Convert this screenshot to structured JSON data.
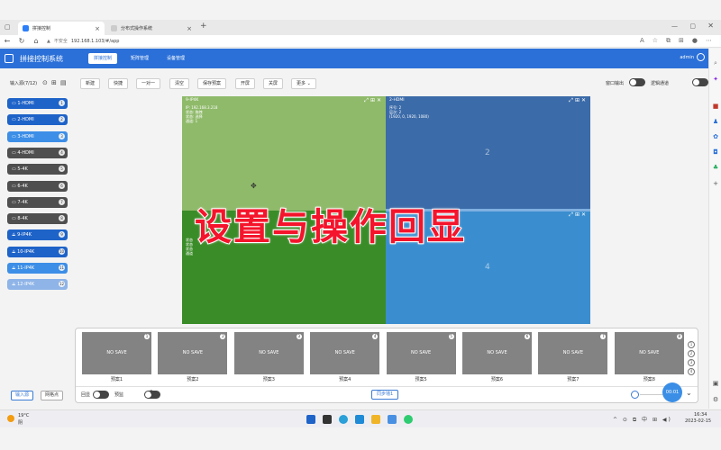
{
  "browser": {
    "tabs": [
      {
        "label": "拼接控制",
        "active": true
      },
      {
        "label": "分布式操作系统",
        "active": false
      }
    ],
    "url_warning": "不安全",
    "url": "192.168.1.103/#/app"
  },
  "app": {
    "title": "拼接控制系统",
    "nav": [
      {
        "label": "拼接控制",
        "active": true
      },
      {
        "label": "矩阵管理",
        "active": false
      },
      {
        "label": "设备管理",
        "active": false
      }
    ],
    "user": "admin"
  },
  "toolbar": {
    "source_label": "输入源(7/12)",
    "buttons": [
      "新建",
      "快捷",
      "一对一",
      "清空",
      "保存预案",
      "开屏",
      "关屏",
      "更多"
    ],
    "window_output_label": "窗口输出",
    "logic_channel_label": "逻辑通道"
  },
  "sources": [
    {
      "label": "1-HDMI",
      "num": "1",
      "color": "#1e63c8"
    },
    {
      "label": "2-HDMI",
      "num": "2",
      "color": "#1e63c8"
    },
    {
      "label": "3-HDMI",
      "num": "3",
      "color": "#3d8ee6"
    },
    {
      "label": "4-HDMI",
      "num": "4",
      "color": "#4f4f4f"
    },
    {
      "label": "5-4K",
      "num": "5",
      "color": "#4f4f4f"
    },
    {
      "label": "6-4K",
      "num": "6",
      "color": "#4f4f4f"
    },
    {
      "label": "7-4K",
      "num": "7",
      "color": "#4f4f4f"
    },
    {
      "label": "8-4K",
      "num": "8",
      "color": "#4f4f4f"
    },
    {
      "label": "9-IP4K",
      "num": "9",
      "color": "#1e63c8"
    },
    {
      "label": "10-IP4K",
      "num": "10",
      "color": "#1e63c8"
    },
    {
      "label": "11-IP4K",
      "num": "11",
      "color": "#3d8ee6"
    },
    {
      "label": "12-IP4K",
      "num": "12",
      "color": "#8eb4e8"
    }
  ],
  "wall": {
    "win1": {
      "title": "9-IP4K",
      "info": "IP: 192.168.3.218\n状态: 拖拽\n状态: 选择\n通道: 1"
    },
    "win2": {
      "title": "2-HDMI",
      "info": "序号: 2\n层次: 2\n(1920, 0, 1920, 1080)",
      "num": "2"
    },
    "win3": {
      "title": "",
      "info": "状态\n状态\n状态\n通道"
    },
    "win4": {
      "num": "4"
    }
  },
  "overlay_text": "设置与操作回显",
  "presets": {
    "cards": [
      {
        "text": "NO SAVE",
        "num": "1",
        "label": "预案1"
      },
      {
        "text": "NO SAVE",
        "num": "2",
        "label": "预案2"
      },
      {
        "text": "NO SAVE",
        "num": "3",
        "label": "预案3"
      },
      {
        "text": "NO SAVE",
        "num": "4",
        "label": "预案4"
      },
      {
        "text": "NO SAVE",
        "num": "5",
        "label": "预案5"
      },
      {
        "text": "NO SAVE",
        "num": "6",
        "label": "预案6"
      },
      {
        "text": "NO SAVE",
        "num": "7",
        "label": "预案7"
      },
      {
        "text": "NO SAVE",
        "num": "8",
        "label": "预案8"
      }
    ],
    "pages": [
      "1",
      "2",
      "3",
      "4"
    ],
    "loop_label": "回显",
    "preview_label": "预监",
    "sync_button": "同步墙1",
    "time_badge": "00:01"
  },
  "footer_left": {
    "input_button": "输入源",
    "grid_button": "网格点"
  },
  "taskbar": {
    "weather_temp": "19°C",
    "weather_desc": "阴",
    "time": "16:34",
    "date": "2023-02-15"
  }
}
